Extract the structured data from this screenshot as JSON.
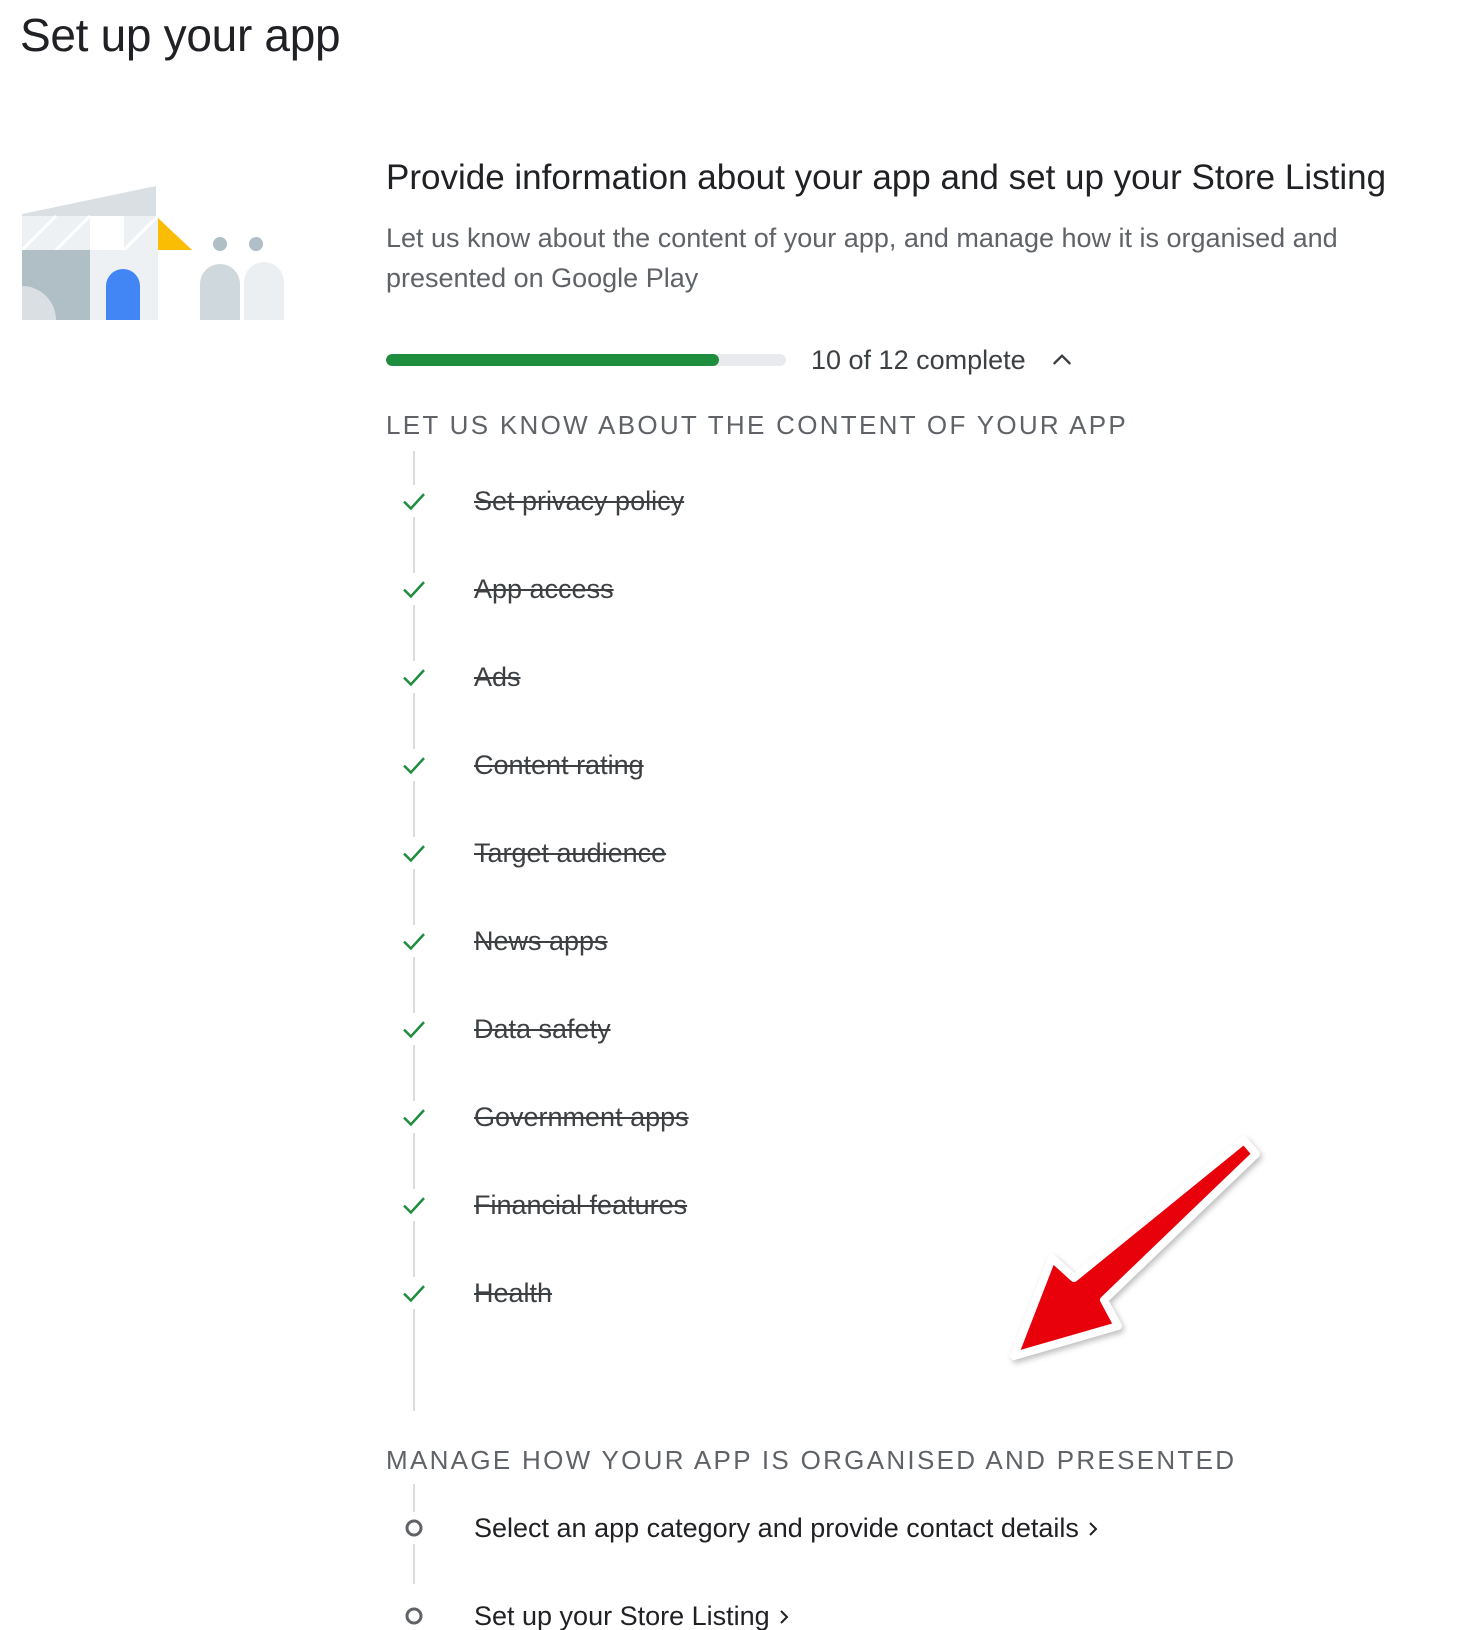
{
  "page": {
    "title": "Set up your app"
  },
  "setup": {
    "heading": "Provide information about your app and set up your Store Listing",
    "description": "Let us know about the content of your app, and manage how it is organised and presented on Google Play",
    "progress": {
      "completed": 10,
      "total": 12,
      "fraction": 0.833,
      "label": "10 of 12 complete",
      "toggle_icon": "chevron-up-icon"
    },
    "groups": [
      {
        "title": "LET US KNOW ABOUT THE CONTENT OF YOUR APP",
        "tasks": [
          {
            "label": "Set privacy policy",
            "status": "done"
          },
          {
            "label": "App access",
            "status": "done"
          },
          {
            "label": "Ads",
            "status": "done"
          },
          {
            "label": "Content rating",
            "status": "done"
          },
          {
            "label": "Target audience",
            "status": "done"
          },
          {
            "label": "News apps",
            "status": "done"
          },
          {
            "label": "Data safety",
            "status": "done"
          },
          {
            "label": "Government apps",
            "status": "done"
          },
          {
            "label": "Financial features",
            "status": "done"
          },
          {
            "label": "Health",
            "status": "done"
          }
        ]
      },
      {
        "title": "MANAGE HOW YOUR APP IS ORGANISED AND PRESENTED",
        "tasks": [
          {
            "label": "Select an app category and provide contact details",
            "status": "pending"
          },
          {
            "label": "Set up your Store Listing",
            "status": "pending"
          }
        ]
      }
    ]
  },
  "colors": {
    "progress_fill": "#1e8e3e",
    "check": "#1e8e3e",
    "annotation_arrow": "#e8000b",
    "illustration_accent_blue": "#4285f4",
    "illustration_accent_yellow": "#fbbc04"
  },
  "annotation": {
    "icon": "red-arrow-icon"
  }
}
